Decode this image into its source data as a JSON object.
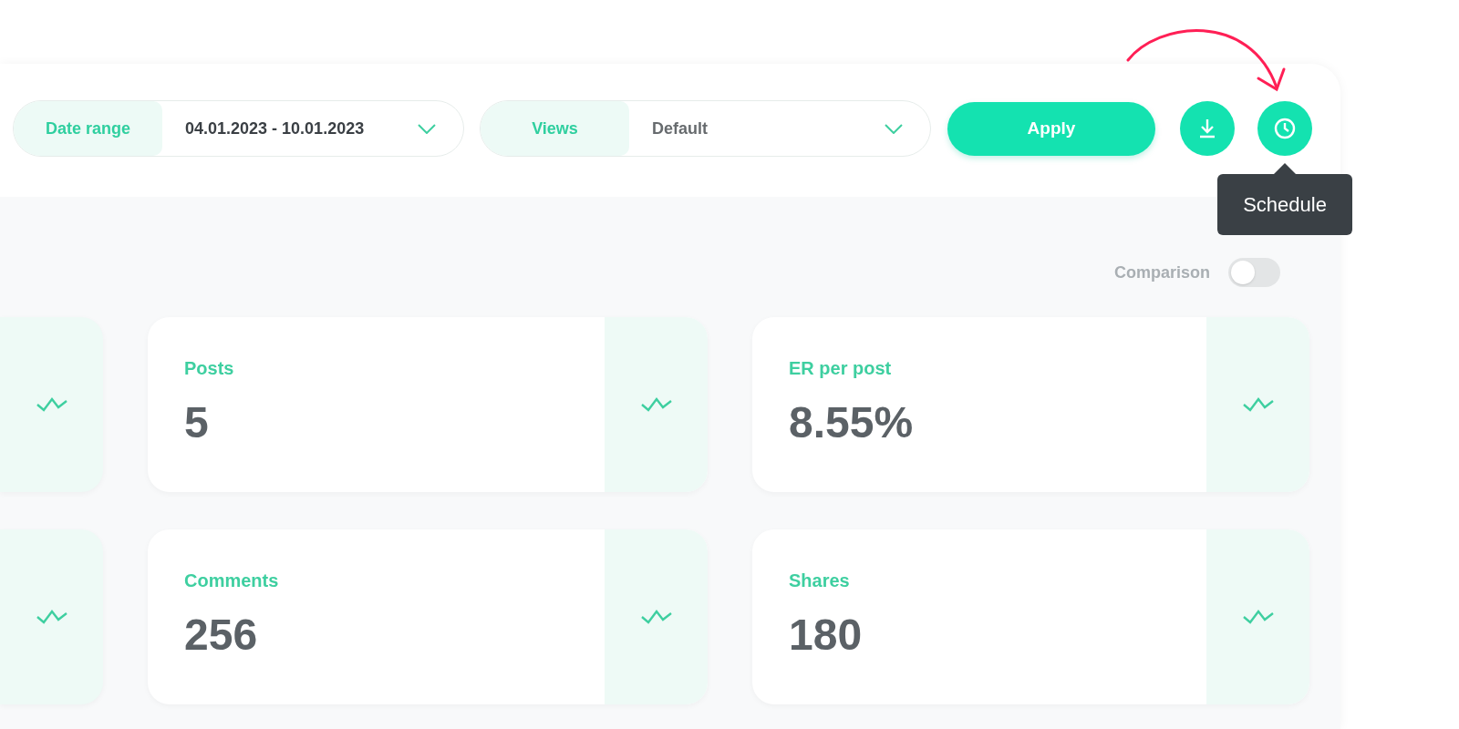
{
  "filters": [
    {
      "kind": "date",
      "label": "Date range",
      "value": "04.01.2023 - 10.01.2023"
    },
    {
      "kind": "select",
      "label": "Views",
      "value": "Default"
    }
  ],
  "apply_button": "Apply",
  "tooltip": "Schedule",
  "comparison": {
    "label": "Comparison",
    "on": false
  },
  "card_rows": [
    [
      {
        "kind": "partial"
      },
      {
        "kind": "metric",
        "label": "Posts",
        "value": "5"
      },
      {
        "kind": "metric",
        "label": "ER per post",
        "value": "8.55%"
      }
    ],
    [
      {
        "kind": "partial"
      },
      {
        "kind": "metric",
        "label": "Comments",
        "value": "256"
      },
      {
        "kind": "metric",
        "label": "Shares",
        "value": "180"
      }
    ]
  ]
}
